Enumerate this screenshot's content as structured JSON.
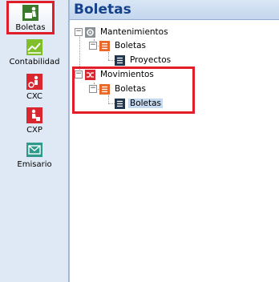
{
  "sidebar": {
    "items": [
      {
        "label": "Boletas",
        "icon": "boletas-icon",
        "color": "#3b7a2c"
      },
      {
        "label": "Contabilidad",
        "icon": "chart-icon",
        "color": "#7fbf2a"
      },
      {
        "label": "CXC",
        "icon": "cxc-icon",
        "color": "#d9262f"
      },
      {
        "label": "CXP",
        "icon": "cxp-icon",
        "color": "#d9262f"
      },
      {
        "label": "Emisario",
        "icon": "envelope-icon",
        "color": "#2e9a8c"
      }
    ]
  },
  "main": {
    "title": "Boletas",
    "tree": {
      "mantenimientos": "Mantenimientos",
      "mant_boletas": "Boletas",
      "proyectos": "Proyectos",
      "movimientos": "Movimientos",
      "mov_boletas": "Boletas",
      "boletas_leaf": "Boletas"
    }
  },
  "colors": {
    "highlight": "#e21d2a",
    "accent": "#15428b",
    "folder": "#e8682a",
    "leaf": "#1f3550"
  }
}
